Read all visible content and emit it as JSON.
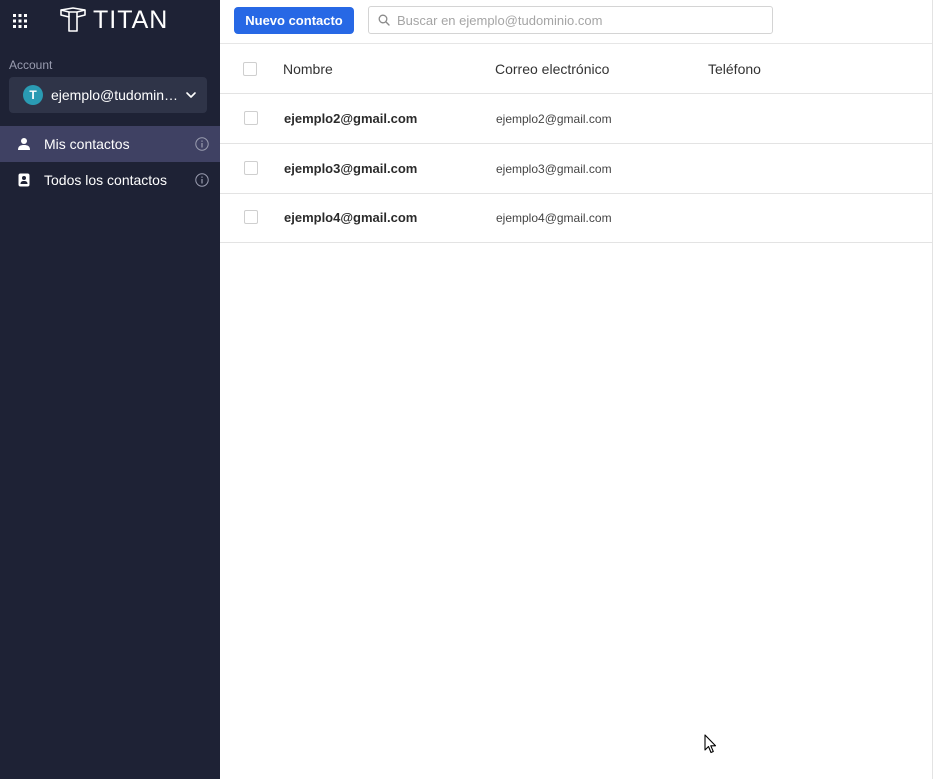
{
  "sidebar": {
    "logo_text": "TITAN",
    "account_label": "Account",
    "account_avatar": "T",
    "account_email": "ejemplo@tudominio.com",
    "nav": [
      {
        "label": "Mis contactos",
        "icon": "person-icon",
        "active": true
      },
      {
        "label": "Todos los contactos",
        "icon": "contact-book-icon",
        "active": false
      }
    ]
  },
  "toolbar": {
    "new_contact_label": "Nuevo contacto",
    "search_placeholder": "Buscar en ejemplo@tudominio.com"
  },
  "table": {
    "columns": [
      "Nombre",
      "Correo electrónico",
      "Teléfono"
    ],
    "rows": [
      {
        "name": "ejemplo2@gmail.com",
        "email": "ejemplo2@gmail.com",
        "phone": ""
      },
      {
        "name": "ejemplo3@gmail.com",
        "email": "ejemplo3@gmail.com",
        "phone": ""
      },
      {
        "name": "ejemplo4@gmail.com",
        "email": "ejemplo4@gmail.com",
        "phone": ""
      }
    ]
  },
  "colors": {
    "sidebar_bg": "#1e2235",
    "active_nav_bg": "#3f4163",
    "primary_button": "#2768e5",
    "avatar": "#2a9bb3"
  }
}
